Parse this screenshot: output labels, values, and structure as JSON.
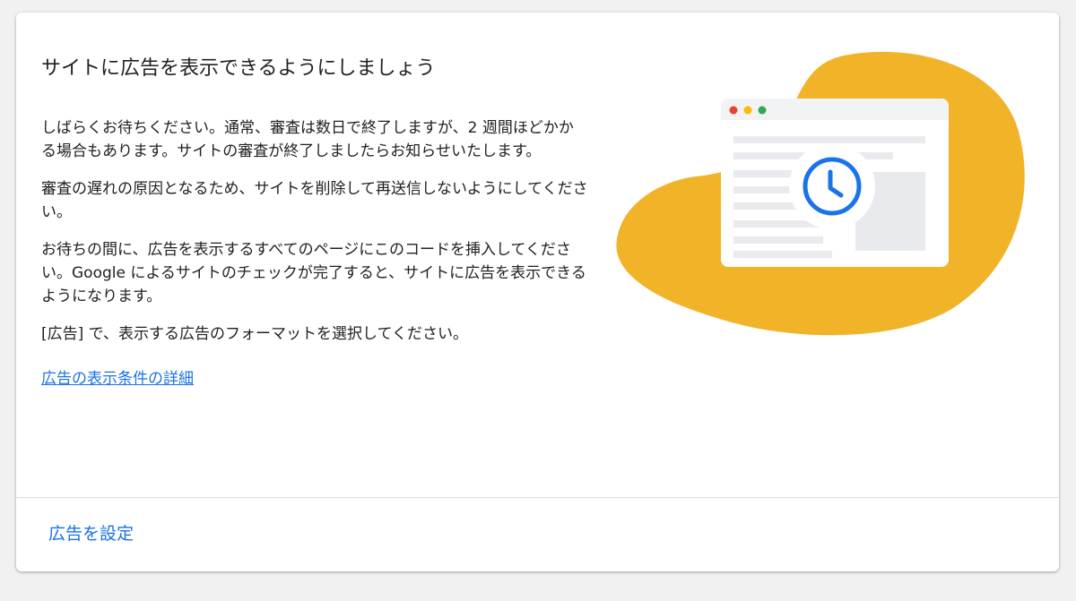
{
  "card": {
    "title": "サイトに広告を表示できるようにしましょう",
    "paragraphs": [
      "しばらくお待ちください。通常、審査は数日で終了しますが、2 週間ほどかかる場合もあります。サイトの審査が終了しましたらお知らせいたします。",
      "審査の遅れの原因となるため、サイトを削除して再送信しないようにしてください。",
      "お待ちの間に、広告を表示するすべてのページにこのコードを挿入してください。Google によるサイトのチェックが完了すると、サイトに広告を表示できるようになります。",
      "[広告] で、表示する広告のフォーマットを選択してください。"
    ],
    "details_link": "広告の表示条件の詳細",
    "action_label": "広告を設定"
  },
  "illustration": {
    "icon": "clock-icon",
    "blob_color": "#f1b327",
    "window_dot_colors": [
      "#ea4335",
      "#fbbc04",
      "#34a853"
    ],
    "clock_color": "#1a73e8"
  }
}
